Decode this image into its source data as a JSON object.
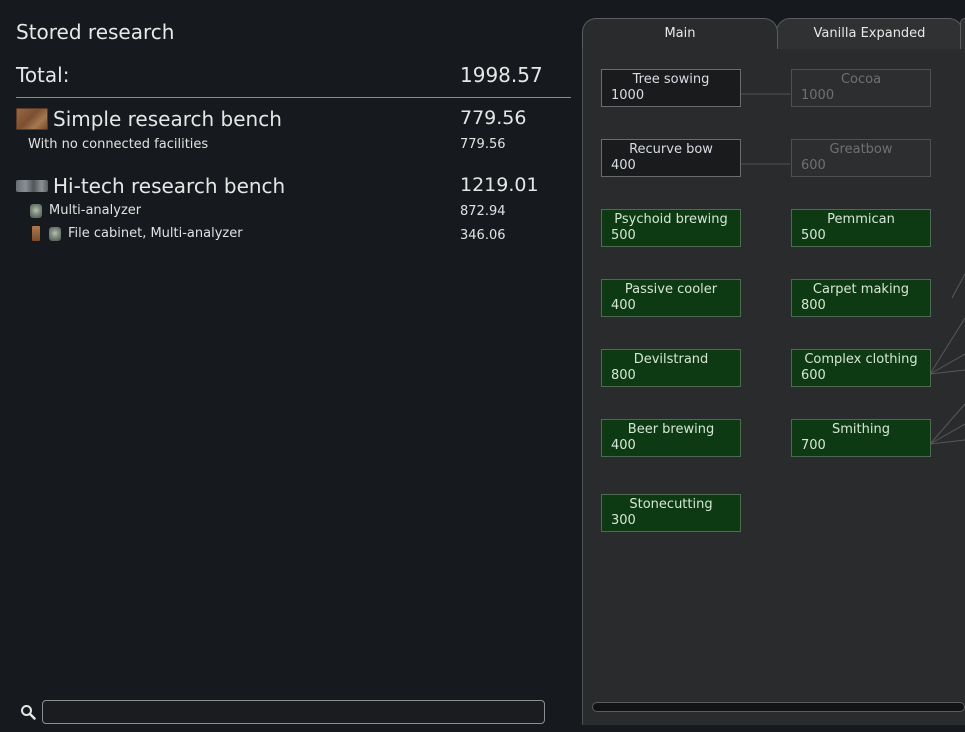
{
  "left_panel": {
    "title": "Stored research",
    "total_label": "Total:",
    "total_value": "1998.57",
    "benches": [
      {
        "name": "Simple research bench",
        "value": "779.56",
        "icon": "simple-research-bench-icon",
        "facilities": [
          {
            "label": "With no connected facilities",
            "value": "779.56"
          }
        ]
      },
      {
        "name": "Hi-tech research bench",
        "value": "1219.01",
        "icon": "hi-tech-research-bench-icon",
        "facilities": [
          {
            "label": "Multi-analyzer",
            "value": "872.94"
          },
          {
            "label": "File cabinet, Multi-analyzer",
            "value": "346.06"
          }
        ]
      }
    ],
    "search": {
      "placeholder": "",
      "value": ""
    }
  },
  "tabs": [
    {
      "label": "Main",
      "active": true
    },
    {
      "label": "Vanilla Expanded",
      "active": false
    }
  ],
  "research_nodes": [
    {
      "name": "Tree sowing",
      "cost": "1000",
      "state": "available"
    },
    {
      "name": "Cocoa",
      "cost": "1000",
      "state": "locked"
    },
    {
      "name": "Recurve bow",
      "cost": "400",
      "state": "available"
    },
    {
      "name": "Greatbow",
      "cost": "600",
      "state": "locked"
    },
    {
      "name": "Psychoid brewing",
      "cost": "500",
      "state": "completed"
    },
    {
      "name": "Pemmican",
      "cost": "500",
      "state": "completed"
    },
    {
      "name": "Passive cooler",
      "cost": "400",
      "state": "completed"
    },
    {
      "name": "Carpet making",
      "cost": "800",
      "state": "completed"
    },
    {
      "name": "Devilstrand",
      "cost": "800",
      "state": "completed"
    },
    {
      "name": "Complex clothing",
      "cost": "600",
      "state": "completed"
    },
    {
      "name": "Beer brewing",
      "cost": "400",
      "state": "completed"
    },
    {
      "name": "Smithing",
      "cost": "700",
      "state": "completed"
    },
    {
      "name": "Stonecutting",
      "cost": "300",
      "state": "completed"
    }
  ],
  "colors": {
    "background": "#16191d",
    "completed_node": "#0d3a12",
    "available_node": "#1a1b1d",
    "locked_node": "#2d2e30"
  }
}
